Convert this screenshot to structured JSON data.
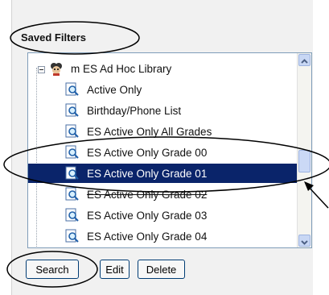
{
  "panel": {
    "title": "Saved Filters"
  },
  "tree": {
    "root_label": "m ES Ad Hoc Library",
    "items": [
      {
        "label": "Active Only"
      },
      {
        "label": "Birthday/Phone List"
      },
      {
        "label": "ES Active Only All Grades"
      },
      {
        "label": "ES Active Only Grade 00"
      },
      {
        "label": "ES Active Only Grade 01",
        "selected": true
      },
      {
        "label": "ES Active Only Grade 02"
      },
      {
        "label": "ES Active Only Grade 03"
      },
      {
        "label": "ES Active Only Grade 04"
      }
    ]
  },
  "buttons": {
    "search": "Search",
    "edit": "Edit",
    "delete": "Delete"
  },
  "colors": {
    "selection": "#0a246a",
    "annotation": "#000000"
  },
  "icons": {
    "root": "library-icon",
    "item": "filter-magnifier-icon"
  }
}
